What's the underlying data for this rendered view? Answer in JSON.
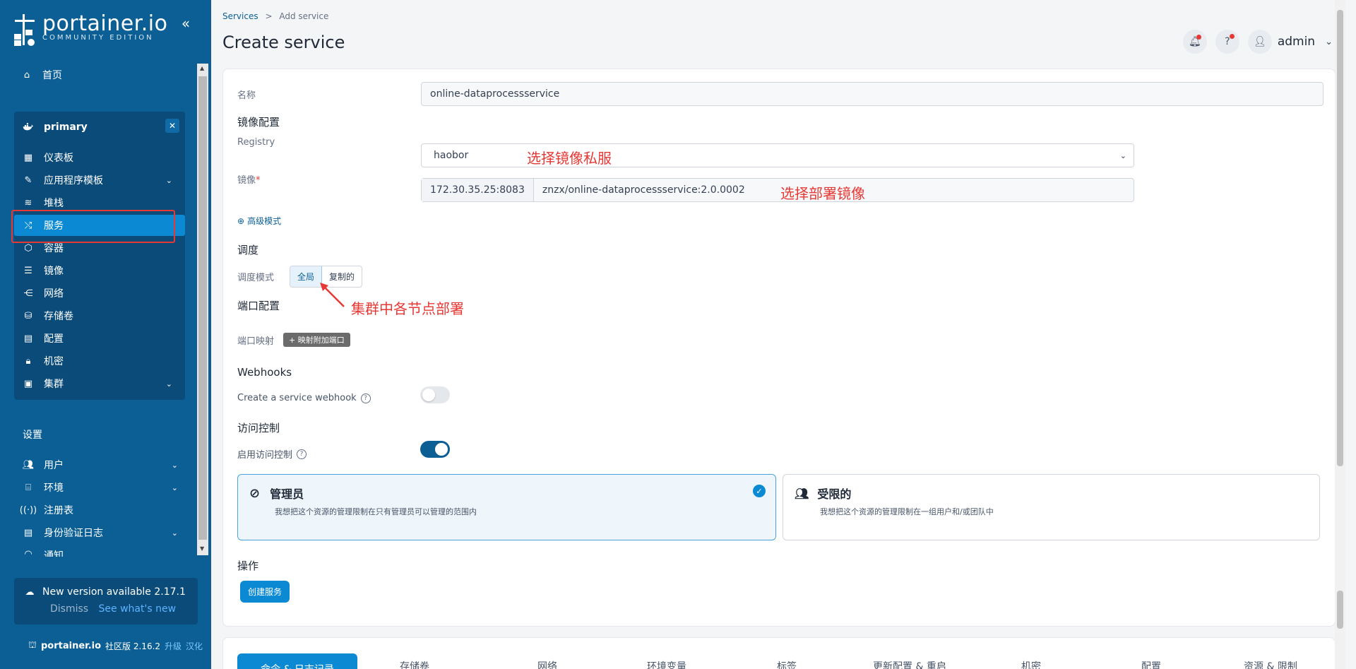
{
  "sidebar": {
    "logo_title": "portainer.io",
    "logo_sub": "COMMUNITY EDITION",
    "home_label": "首页",
    "env": {
      "name": "primary"
    },
    "nav": [
      {
        "label": "仪表板",
        "icon": "dashboard-icon"
      },
      {
        "label": "应用程序模板",
        "icon": "edit-icon",
        "expandable": true
      },
      {
        "label": "堆栈",
        "icon": "layers-icon"
      },
      {
        "label": "服务",
        "icon": "shuffle-icon",
        "active": true
      },
      {
        "label": "容器",
        "icon": "box-icon"
      },
      {
        "label": "镜像",
        "icon": "list-icon"
      },
      {
        "label": "网络",
        "icon": "network-icon"
      },
      {
        "label": "存储卷",
        "icon": "database-icon"
      },
      {
        "label": "配置",
        "icon": "clipboard-icon"
      },
      {
        "label": "机密",
        "icon": "lock-icon"
      },
      {
        "label": "集群",
        "icon": "cluster-icon",
        "expandable": true
      }
    ],
    "settings_title": "设置",
    "settings": [
      {
        "label": "用户",
        "expandable": true
      },
      {
        "label": "环境",
        "expandable": true
      },
      {
        "label": "注册表",
        "expandable": false
      },
      {
        "label": "身份验证日志",
        "expandable": true
      },
      {
        "label": "通知",
        "expandable": false
      }
    ],
    "update": {
      "title": "New version available 2.17.1",
      "dismiss": "Dismiss",
      "whatsnew": "See what's new"
    },
    "footer": {
      "brand": "portainer.io",
      "edition": "社区版 2.16.2",
      "upgrade": "升级",
      "localize": "汉化"
    }
  },
  "header": {
    "breadcrumb_link": "Services",
    "breadcrumb_sep": ">",
    "breadcrumb_current": "Add service",
    "title": "Create service",
    "user": "admin"
  },
  "form": {
    "name_label": "名称",
    "name_value": "online-dataprocessservice",
    "image_section": "镜像配置",
    "registry_label": "Registry",
    "registry_value": "haobor",
    "registry_annotation": "选择镜像私服",
    "image_label": "镜像",
    "image_required": "*",
    "image_prefix": "172.30.35.25:8083",
    "image_value": "znzx/online-dataprocessservice:2.0.0002",
    "image_annotation": "选择部署镜像",
    "advanced_mode": "高级模式",
    "scheduling_section": "调度",
    "scheduling_mode_label": "调度模式",
    "scheduling_global": "全局",
    "scheduling_replicated": "复制的",
    "scheduling_annotation": "集群中各节点部署",
    "port_section": "端口配置",
    "port_mapping_label": "端口映射",
    "port_add_button": "+ 映射附加端口",
    "webhooks_section": "Webhooks",
    "webhook_label": "Create a service webhook",
    "access_section": "访问控制",
    "access_label": "启用访问控制",
    "admin_title": "管理员",
    "admin_desc": "我想把这个资源的管理限制在只有管理员可以管理的范围内",
    "restricted_title": "受限的",
    "restricted_desc": "我想把这个资源的管理限制在一组用户和/或团队中",
    "actions_section": "操作",
    "create_button": "创建服务"
  },
  "tabs": [
    "命令 & 日志记录",
    "存储卷",
    "网络",
    "环境变量",
    "标签",
    "更新配置 & 重启",
    "机密",
    "配置",
    "资源 & 限制"
  ],
  "colors": {
    "sidebar_bg": "#0b5f95",
    "accent": "#0b8ad3",
    "annotation": "#e53935"
  }
}
